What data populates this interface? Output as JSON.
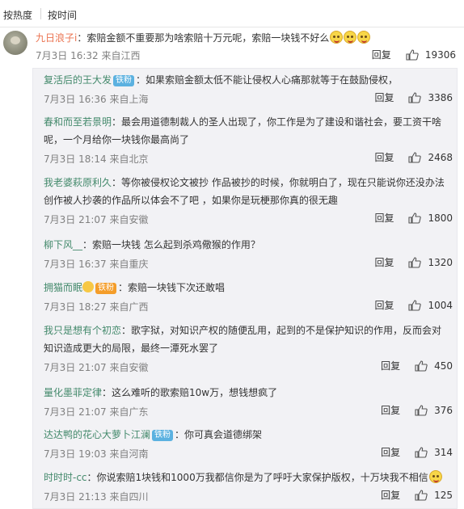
{
  "sort": {
    "tab_hot": "按热度",
    "tab_time": "按时间"
  },
  "main": {
    "user": "九日浪子i",
    "text": "：索赔金额不重要那为啥索赔十万元呢，索赔一块钱不好么",
    "time": "7月3日 16:32 来自江西",
    "reply_label": "回复",
    "likes": "19306"
  },
  "replies": [
    {
      "user": "复活后的王大发",
      "badge": "铁粉",
      "text": "：如果索赔金额太低不能让侵权人心痛那就等于在鼓励侵权，",
      "time": "7月3日 16:36 来自上海",
      "reply_label": "回复",
      "likes": "3386"
    },
    {
      "user": "春和而至若景明",
      "text": "：最会用道德制裁人的圣人出现了，你工作是为了建设和谐社会，要工资干啥呢，一个月给你一块钱你最高尚了",
      "time": "7月3日 18:14 来自北京",
      "reply_label": "回复",
      "likes": "2468"
    },
    {
      "user": "我老婆萩原利久",
      "text": "：等你被侵权论文被抄 作品被抄的时候，你就明白了，现在只能说你还没办法创作被人抄袭的作品所以体会不了吧 ，如果你是玩梗那你真的很无趣",
      "time": "7月3日 21:07 来自安徽",
      "reply_label": "回复",
      "likes": "1800"
    },
    {
      "user": "柳下风__",
      "text": "：索赔一块钱 怎么起到杀鸡儆猴的作用？",
      "time": "7月3日 16:37 来自重庆",
      "reply_label": "回复",
      "likes": "1320"
    },
    {
      "user": "拥猫而眠",
      "badge": "铁粉",
      "text": "：索赔一块钱下次还敢唱",
      "time": "7月3日 18:27 来自广西",
      "reply_label": "回复",
      "likes": "1004"
    },
    {
      "user": "我只是想有个初恋",
      "text": "：歌字狱，对知识产权的随便乱用，起到的不是保护知识的作用，反而会对知识造成更大的局限，最终一潭死水罢了",
      "time": "7月3日 21:07 来自安徽",
      "reply_label": "回复",
      "likes": "450"
    },
    {
      "user": "量化墨菲定律",
      "text": "：这么难听的歌索赔10w万，想钱想疯了",
      "time": "7月3日 21:07 来自广东",
      "reply_label": "回复",
      "likes": "376"
    },
    {
      "user": "达达鸭的花心大萝卜江澜",
      "badge": "铁粉",
      "text": "：你可真会道德绑架",
      "time": "7月3日 19:03 来自河南",
      "reply_label": "回复",
      "likes": "314"
    },
    {
      "user": "时时时-cc",
      "text": "：你说索赔1块钱和1000万我都信你是为了呼吁大家保护版权，十万块我不相信",
      "time": "7月3日 21:13 来自四川",
      "reply_label": "回复",
      "likes": "125"
    }
  ]
}
